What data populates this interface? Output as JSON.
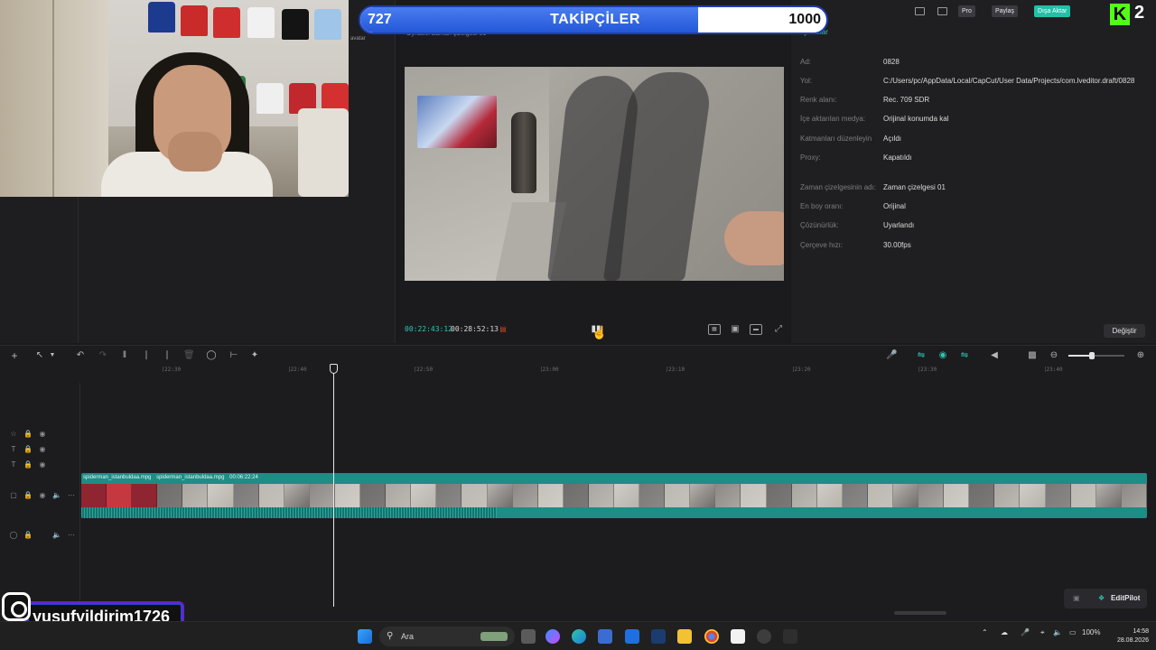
{
  "overlay": {
    "followers": {
      "current": "727",
      "title": "TAKİPÇİLER",
      "goal": "1000",
      "progress": 0.727
    },
    "kick": {
      "count": "2"
    },
    "instagram": {
      "handle": "yusufyildirim1726"
    }
  },
  "header": {
    "pro_label": "Pro",
    "share_label": "Paylaş",
    "export_label": "Dışa Aktar",
    "left_fragment": "avatar",
    "preview_title_fragment": "Oynatıcı Zaman çizelgesi 01",
    "props_tab": "Ayrıntılar"
  },
  "preview": {
    "timecode_current": "00:22:43:12",
    "timecode_total": "00:28:52:13"
  },
  "properties": {
    "rows": [
      {
        "label": "Ad:",
        "value": "0828"
      },
      {
        "label": "Yol:",
        "value": "C:/Users/pc/AppData/Local/CapCut/User Data/Projects/com.lveditor.draft/0828"
      },
      {
        "label": "Renk alanı:",
        "value": "Rec. 709 SDR"
      },
      {
        "label": "İçe aktarılan medya:",
        "value": "Orijinal konumda kal"
      },
      {
        "label": "Katmanları düzenleyin",
        "value": "Açıldı"
      },
      {
        "label": "Proxy:",
        "value": "Kapatıldı"
      },
      {
        "label": "Zaman çizelgesinin adı:",
        "value": "Zaman çizelgesi 01"
      },
      {
        "label": "En boy oranı:",
        "value": "Orijinal"
      },
      {
        "label": "Çözünürlük:",
        "value": "Uyarlandı"
      },
      {
        "label": "Çerçeve hızı:",
        "value": "30.00fps"
      }
    ],
    "change_button": "Değiştir"
  },
  "timeline": {
    "ruler": [
      "22:30",
      "22:40",
      "22:50",
      "23:00",
      "23:10",
      "23:20",
      "23:30",
      "23:40"
    ],
    "clip": {
      "name_a": "spiderman_istanbuldaa.mpg",
      "name_b": "spiderman_istanbuldaa.mpg",
      "duration": "00:06:22:24"
    },
    "editpilot_label": "EditPilot"
  },
  "taskbar": {
    "search_placeholder": "Ara",
    "battery": "100%",
    "time": "14:58",
    "date": "28.08.2026"
  },
  "colors": {
    "accent": "#2ec7b5",
    "clip": "#1f8c86",
    "export": "#22c0a8",
    "follow_fill": "#2457d8",
    "kick": "#53fc18"
  },
  "icons": [
    "layout-icon",
    "search-icon",
    "windows-icon",
    "play-icon",
    "mic-icon",
    "zoom-in-icon",
    "zoom-out-icon",
    "eye-icon",
    "lock-icon",
    "audio-icon",
    "fullscreen-icon",
    "instagram-icon"
  ]
}
